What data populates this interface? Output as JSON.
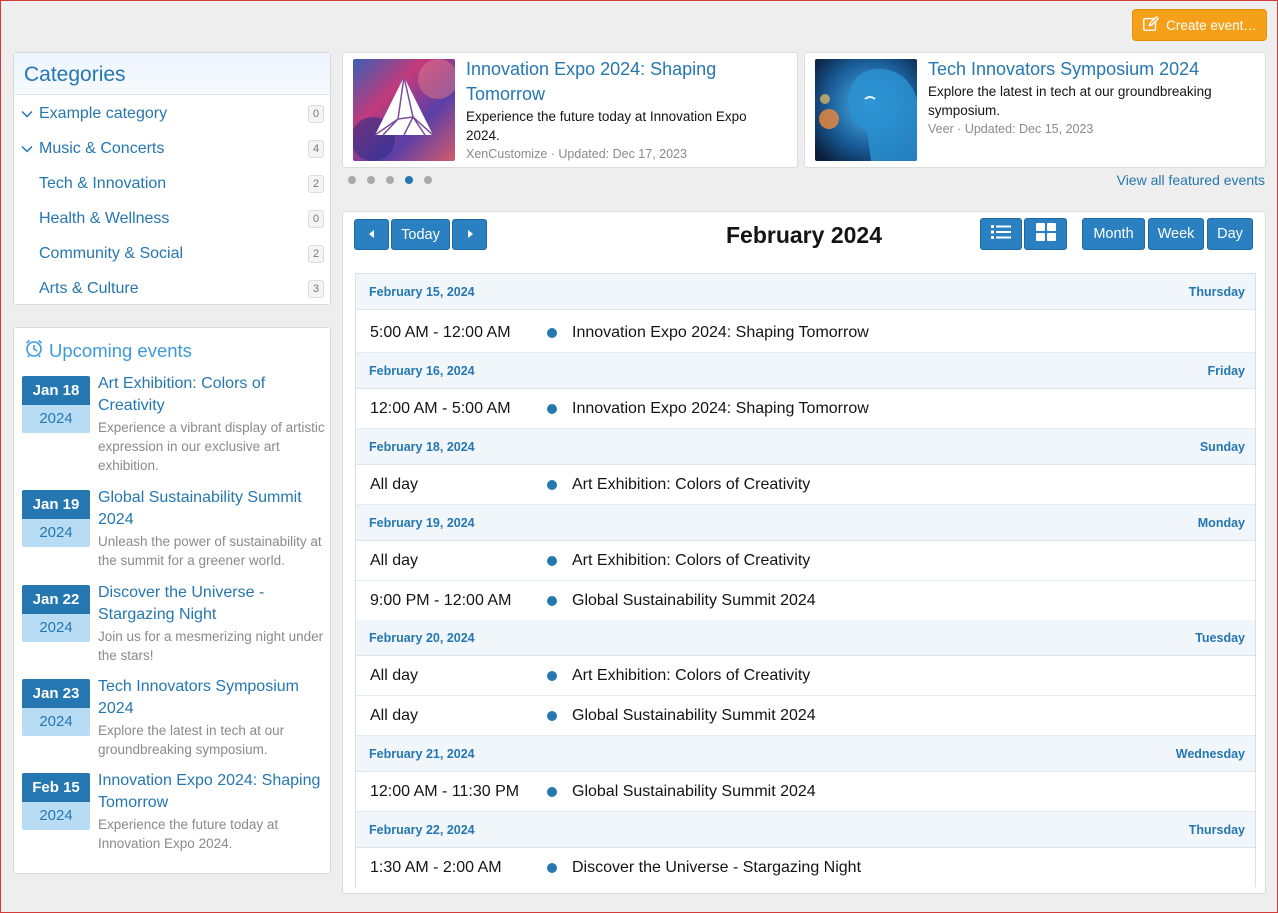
{
  "header": {
    "create_label": "Create event…"
  },
  "categories": {
    "title": "Categories",
    "items": [
      {
        "label": "Example category",
        "count": "0",
        "expanded": true
      },
      {
        "label": "Music & Concerts",
        "count": "4",
        "expanded": true
      },
      {
        "label": "Tech & Innovation",
        "count": "2",
        "expanded": false
      },
      {
        "label": "Health & Wellness",
        "count": "0",
        "expanded": false
      },
      {
        "label": "Community & Social",
        "count": "2",
        "expanded": false
      },
      {
        "label": "Arts & Culture",
        "count": "3",
        "expanded": false
      }
    ]
  },
  "upcoming": {
    "title": "Upcoming events",
    "items": [
      {
        "month_day": "Jan 18",
        "year": "2024",
        "title": "Art Exhibition: Colors of Creativity",
        "desc": "Experience a vibrant display of artistic expression in our exclusive art exhibition."
      },
      {
        "month_day": "Jan 19",
        "year": "2024",
        "title": "Global Sustainability Summit 2024",
        "desc": "Unleash the power of sustainability at the summit for a greener world."
      },
      {
        "month_day": "Jan 22",
        "year": "2024",
        "title": "Discover the Universe - Stargazing Night",
        "desc": "Join us for a mesmerizing night under the stars!"
      },
      {
        "month_day": "Jan 23",
        "year": "2024",
        "title": "Tech Innovators Symposium 2024",
        "desc": "Explore the latest in tech at our groundbreaking symposium."
      },
      {
        "month_day": "Feb 15",
        "year": "2024",
        "title": "Innovation Expo 2024: Shaping Tomorrow",
        "desc": "Experience the future today at Innovation Expo 2024."
      }
    ]
  },
  "featured": {
    "cards": [
      {
        "title": "Innovation Expo 2024: Shaping Tomorrow",
        "desc": "Experience the future today at Innovation Expo 2024.",
        "meta": "XenCustomize · Updated: Dec 17, 2023"
      },
      {
        "title": "Tech Innovators Symposium 2024",
        "desc": "Explore the latest in tech at our groundbreaking symposium.",
        "meta": "Veer · Updated: Dec 15, 2023"
      }
    ],
    "active_dot": 4,
    "dot_count": 5,
    "view_all": "View all featured events"
  },
  "calendar": {
    "title": "February 2024",
    "today_label": "Today",
    "month_label": "Month",
    "week_label": "Week",
    "day_label": "Day",
    "groups": [
      {
        "date": "February 15, 2024",
        "weekday": "Thursday",
        "events": [
          {
            "time": "5:00 AM - 12:00 AM",
            "name": "Innovation Expo 2024: Shaping Tomorrow"
          }
        ]
      },
      {
        "date": "February 16, 2024",
        "weekday": "Friday",
        "events": [
          {
            "time": "12:00 AM - 5:00 AM",
            "name": "Innovation Expo 2024: Shaping Tomorrow"
          }
        ]
      },
      {
        "date": "February 18, 2024",
        "weekday": "Sunday",
        "events": [
          {
            "time": "All day",
            "name": "Art Exhibition: Colors of Creativity"
          }
        ]
      },
      {
        "date": "February 19, 2024",
        "weekday": "Monday",
        "events": [
          {
            "time": "All day",
            "name": "Art Exhibition: Colors of Creativity"
          },
          {
            "time": "9:00 PM - 12:00 AM",
            "name": "Global Sustainability Summit 2024"
          }
        ]
      },
      {
        "date": "February 20, 2024",
        "weekday": "Tuesday",
        "events": [
          {
            "time": "All day",
            "name": "Art Exhibition: Colors of Creativity"
          },
          {
            "time": "All day",
            "name": "Global Sustainability Summit 2024"
          }
        ]
      },
      {
        "date": "February 21, 2024",
        "weekday": "Wednesday",
        "events": [
          {
            "time": "12:00 AM - 11:30 PM",
            "name": "Global Sustainability Summit 2024"
          }
        ]
      },
      {
        "date": "February 22, 2024",
        "weekday": "Thursday",
        "events": [
          {
            "time": "1:30 AM - 2:00 AM",
            "name": "Discover the Universe - Stargazing Night"
          }
        ]
      }
    ]
  },
  "colors": {
    "accent": "#2577b1",
    "create_button": "#f5a019"
  }
}
